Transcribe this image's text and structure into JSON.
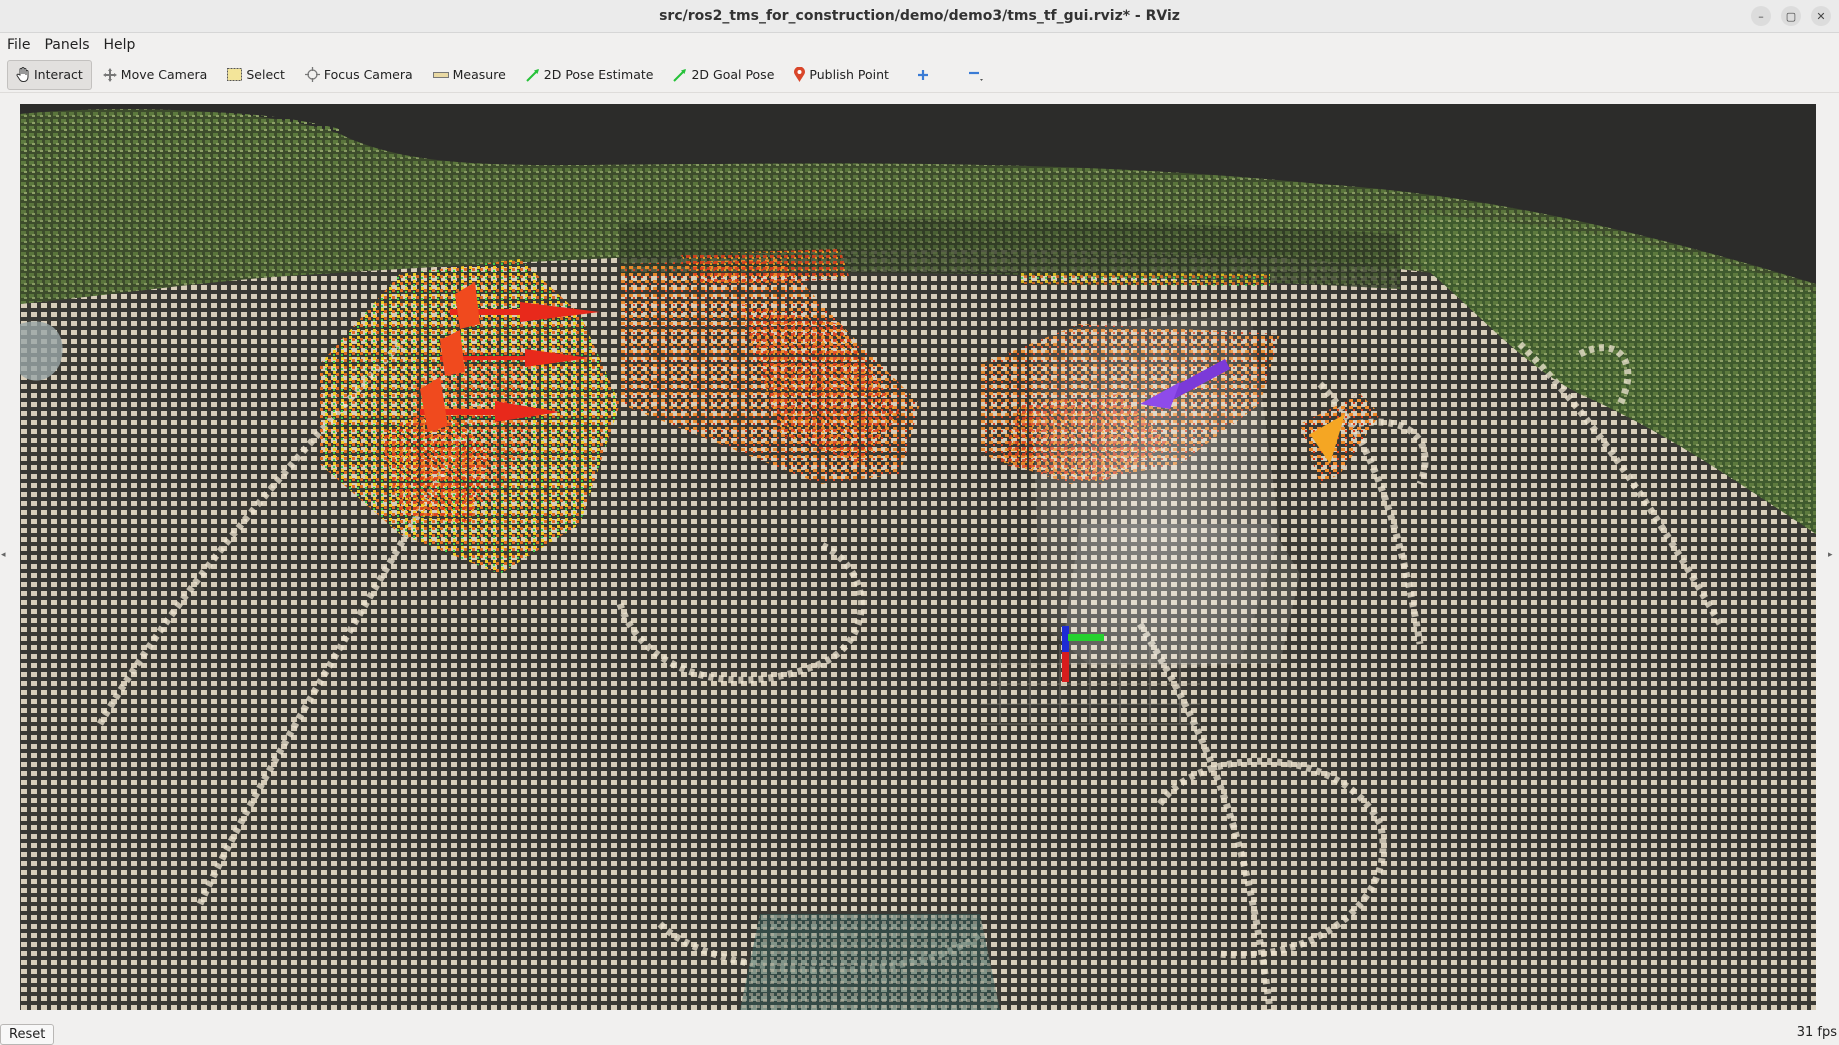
{
  "window": {
    "title": "src/ros2_tms_for_construction/demo/demo3/tms_tf_gui.rviz* - RViz",
    "controls": [
      "–",
      "▢",
      "✕"
    ]
  },
  "menu": [
    "File",
    "Panels",
    "Help"
  ],
  "toolbar": {
    "tools": [
      {
        "label": "Interact",
        "icon": "hand-icon"
      },
      {
        "label": "Move Camera",
        "icon": "move-camera-icon"
      },
      {
        "label": "Select",
        "icon": "select-icon"
      },
      {
        "label": "Focus Camera",
        "icon": "focus-camera-icon"
      },
      {
        "label": "Measure",
        "icon": "measure-icon"
      },
      {
        "label": "2D Pose Estimate",
        "icon": "pose-estimate-icon"
      },
      {
        "label": "2D Goal Pose",
        "icon": "goal-pose-icon"
      },
      {
        "label": "Publish Point",
        "icon": "publish-point-icon"
      }
    ],
    "active_tool": "Interact"
  },
  "viewport": {
    "description_colors": {
      "ground": "#c9c0ad",
      "vegetation": "#4d6b35",
      "excavator_hot": "#e0401a",
      "excavator_warm": "#f08a2a",
      "arrow": "#e8291b"
    }
  },
  "status": {
    "reset_label": "Reset",
    "fps": "31 fps"
  }
}
